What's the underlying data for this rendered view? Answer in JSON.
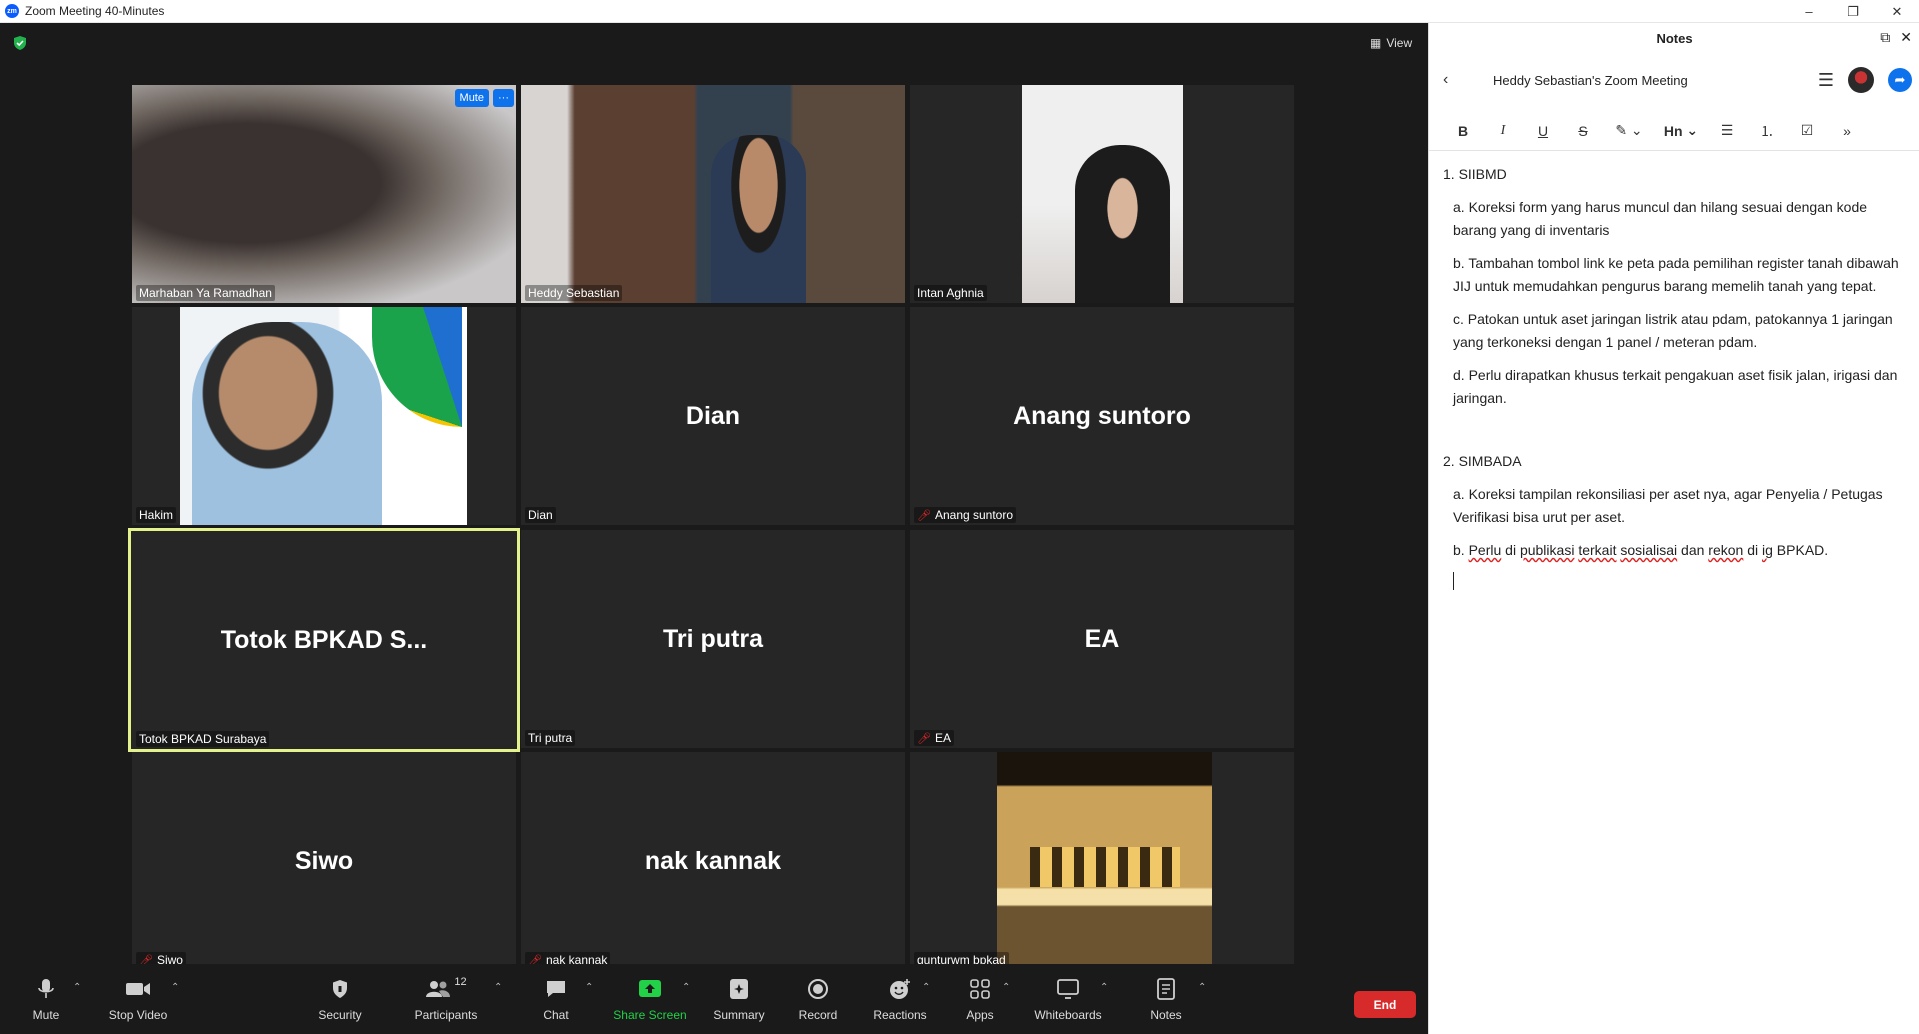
{
  "window": {
    "title": "Zoom Meeting 40-Minutes",
    "logo_text": "zm",
    "minimize": "–",
    "maximize": "❐",
    "close": "✕"
  },
  "meeting": {
    "view_label": "View",
    "tile_controls": {
      "mute": "Mute",
      "more": "···"
    },
    "participants": [
      {
        "name": "Marhaban Ya Ramadhan",
        "video": true,
        "muted": false
      },
      {
        "name": "Heddy Sebastian",
        "video": true,
        "muted": false
      },
      {
        "name": "Intan Aghnia",
        "video": true,
        "muted": false
      },
      {
        "name": "Hakim",
        "video": true,
        "muted": false
      },
      {
        "name": "Dian",
        "display": "Dian",
        "video": false,
        "muted": false
      },
      {
        "name": "Anang suntoro",
        "display": "Anang suntoro",
        "video": false,
        "muted": true
      },
      {
        "name": "Totok BPKAD Surabaya",
        "display": "Totok  BPKAD  S...",
        "video": false,
        "muted": false,
        "active_speaker": true
      },
      {
        "name": "Tri putra",
        "display": "Tri putra",
        "video": false,
        "muted": false
      },
      {
        "name": "EA",
        "display": "EA",
        "video": false,
        "muted": true
      },
      {
        "name": "Siwo",
        "display": "Siwo",
        "video": false,
        "muted": true
      },
      {
        "name": "nak kannak",
        "display": "nak kannak",
        "video": false,
        "muted": true
      },
      {
        "name": "gunturwm bpkad",
        "video": true,
        "muted": false
      }
    ]
  },
  "toolbar": {
    "mute": "Mute",
    "stop_video": "Stop Video",
    "security": "Security",
    "participants": "Participants",
    "participants_count": "12",
    "chat": "Chat",
    "share_screen": "Share Screen",
    "summary": "Summary",
    "record": "Record",
    "reactions": "Reactions",
    "apps": "Apps",
    "whiteboards": "Whiteboards",
    "notes": "Notes",
    "end": "End",
    "share_color": "#22d148",
    "end_color": "#d72b2b"
  },
  "notes": {
    "panel_title": "Notes",
    "doc_title": "Heddy Sebastian's Zoom Meeting",
    "format": {
      "bold": "B",
      "italic": "I",
      "underline": "U",
      "strike": "S",
      "heading": "Hn"
    },
    "sections": [
      {
        "heading": "1. SIIBMD",
        "items": [
          "a. Koreksi form yang harus muncul dan hilang sesuai dengan kode barang yang di inventaris",
          "b. Tambahan tombol link ke peta pada pemilihan register tanah dibawah JIJ untuk memudahkan pengurus barang memelih tanah yang tepat.",
          "c. Patokan untuk aset jaringan listrik atau pdam, patokannya 1 jaringan yang terkoneksi dengan 1 panel / meteran pdam.",
          "d. Perlu dirapatkan khusus terkait pengakuan aset fisik jalan, irigasi dan jaringan."
        ]
      },
      {
        "heading": "2. SIMBADA",
        "items": [
          "a. Koreksi tampilan rekonsiliasi per aset nya, agar Penyelia / Petugas Verifikasi bisa urut per aset."
        ],
        "last_item": {
          "prefix": "b. ",
          "w1": "Perlu",
          "w2": " di ",
          "w3": "publikasi",
          "w4": " ",
          "w5": "terkait",
          "w6": " ",
          "w7": "sosialisai",
          "w8": " dan ",
          "w9": "rekon",
          "w10": " di ",
          "w11": "ig",
          "w12": " BPKAD."
        }
      }
    ]
  }
}
